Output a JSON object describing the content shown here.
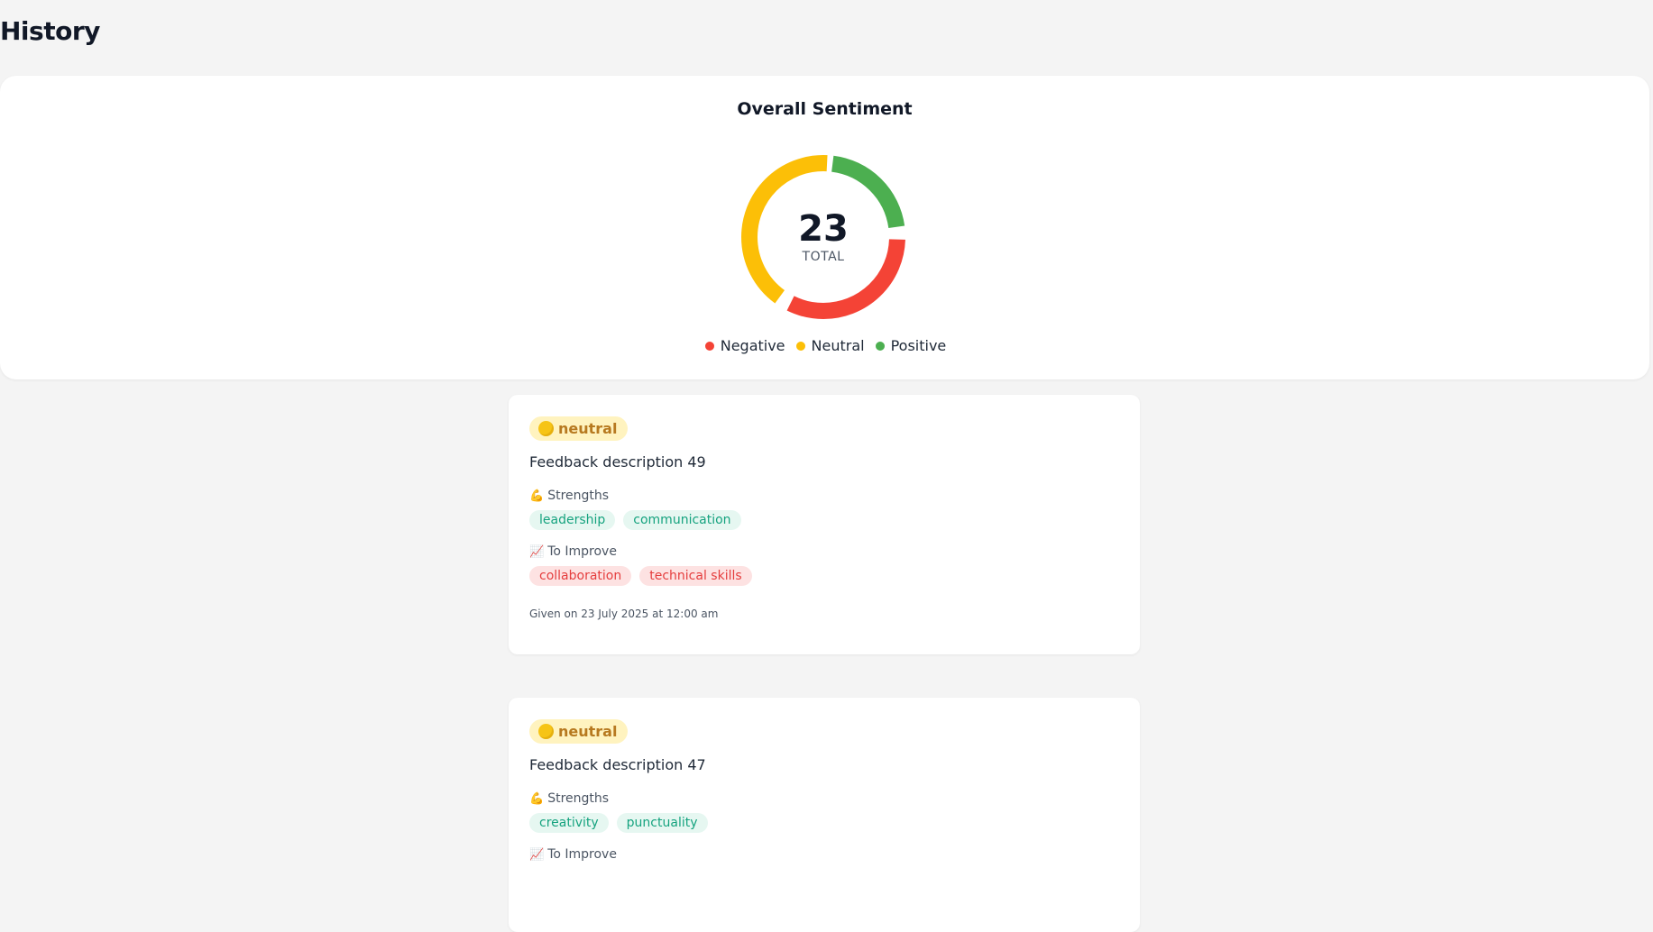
{
  "page": {
    "title": "History"
  },
  "sentiment": {
    "title": "Overall Sentiment",
    "total": "23",
    "total_label": "TOTAL",
    "segments": [
      {
        "label": "Negative",
        "color": "#f44336",
        "fraction": 0.33
      },
      {
        "label": "Neutral",
        "color": "#fcbf07",
        "fraction": 0.42
      },
      {
        "label": "Positive",
        "color": "#4caf50",
        "fraction": 0.22
      }
    ],
    "legend": [
      {
        "label": "Negative",
        "color": "#f44336"
      },
      {
        "label": "Neutral",
        "color": "#fcbf07"
      },
      {
        "label": "Positive",
        "color": "#4caf50"
      }
    ]
  },
  "feedback": [
    {
      "sentiment": "neutral",
      "description": "Feedback description 49",
      "strengths_label": "Strengths",
      "strengths_icon": "💪",
      "strengths": [
        "leadership",
        "communication"
      ],
      "improve_label": "To Improve",
      "improve_icon": "📈",
      "improve": [
        "collaboration",
        "technical skills"
      ],
      "given_on": "Given on 23 July 2025 at 12:00 am"
    },
    {
      "sentiment": "neutral",
      "description": "Feedback description 47",
      "strengths_label": "Strengths",
      "strengths_icon": "💪",
      "strengths": [
        "creativity",
        "punctuality"
      ],
      "improve_label": "To Improve",
      "improve_icon": "📈"
    }
  ]
}
